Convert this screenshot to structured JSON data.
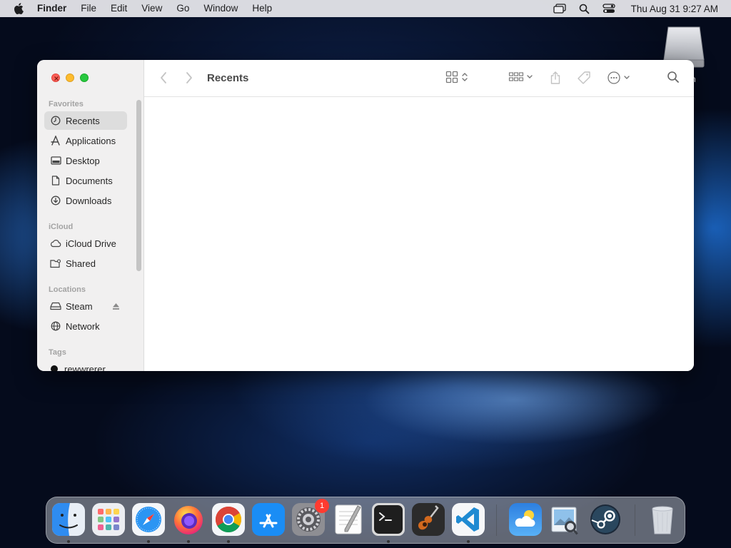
{
  "menubar": {
    "app_name": "Finder",
    "menus": [
      "File",
      "Edit",
      "View",
      "Go",
      "Window",
      "Help"
    ],
    "clock": "Thu Aug 31  9:27 AM",
    "status_icons": [
      "screen-mirroring-icon",
      "spotlight-search-icon",
      "control-center-icon"
    ]
  },
  "desktop": {
    "disk_label": "n"
  },
  "window": {
    "title": "Recents",
    "sidebar": {
      "sections": {
        "favorites": "Favorites",
        "icloud": "iCloud",
        "locations": "Locations",
        "tags": "Tags"
      },
      "favorites": [
        {
          "label": "Recents",
          "icon": "clock-icon",
          "selected": true
        },
        {
          "label": "Applications",
          "icon": "applications-icon"
        },
        {
          "label": "Desktop",
          "icon": "desktop-icon"
        },
        {
          "label": "Documents",
          "icon": "document-icon"
        },
        {
          "label": "Downloads",
          "icon": "download-icon"
        }
      ],
      "icloud": [
        {
          "label": "iCloud Drive",
          "icon": "cloud-icon"
        },
        {
          "label": "Shared",
          "icon": "shared-folder-icon"
        }
      ],
      "locations": [
        {
          "label": "Steam",
          "icon": "drive-icon",
          "ejectable": true
        },
        {
          "label": "Network",
          "icon": "globe-icon"
        }
      ],
      "tags": [
        {
          "label": "rewwrerer",
          "color": "#111111"
        }
      ]
    }
  },
  "dock": {
    "apps": [
      "Finder",
      "Launchpad",
      "Safari",
      "Firefox",
      "Chrome",
      "App Store",
      "System Settings",
      "TextEdit",
      "Terminal",
      "GarageBand",
      "Visual Studio Code",
      "Weather",
      "Preview",
      "Steam",
      "Trash"
    ],
    "settings_badge": "1"
  },
  "colors": {
    "close": "#fe5f57",
    "minimize": "#febc2e",
    "maximize": "#28c840",
    "sidebar_bg": "#f1f0f0",
    "selected_bg": "#dddddd"
  }
}
